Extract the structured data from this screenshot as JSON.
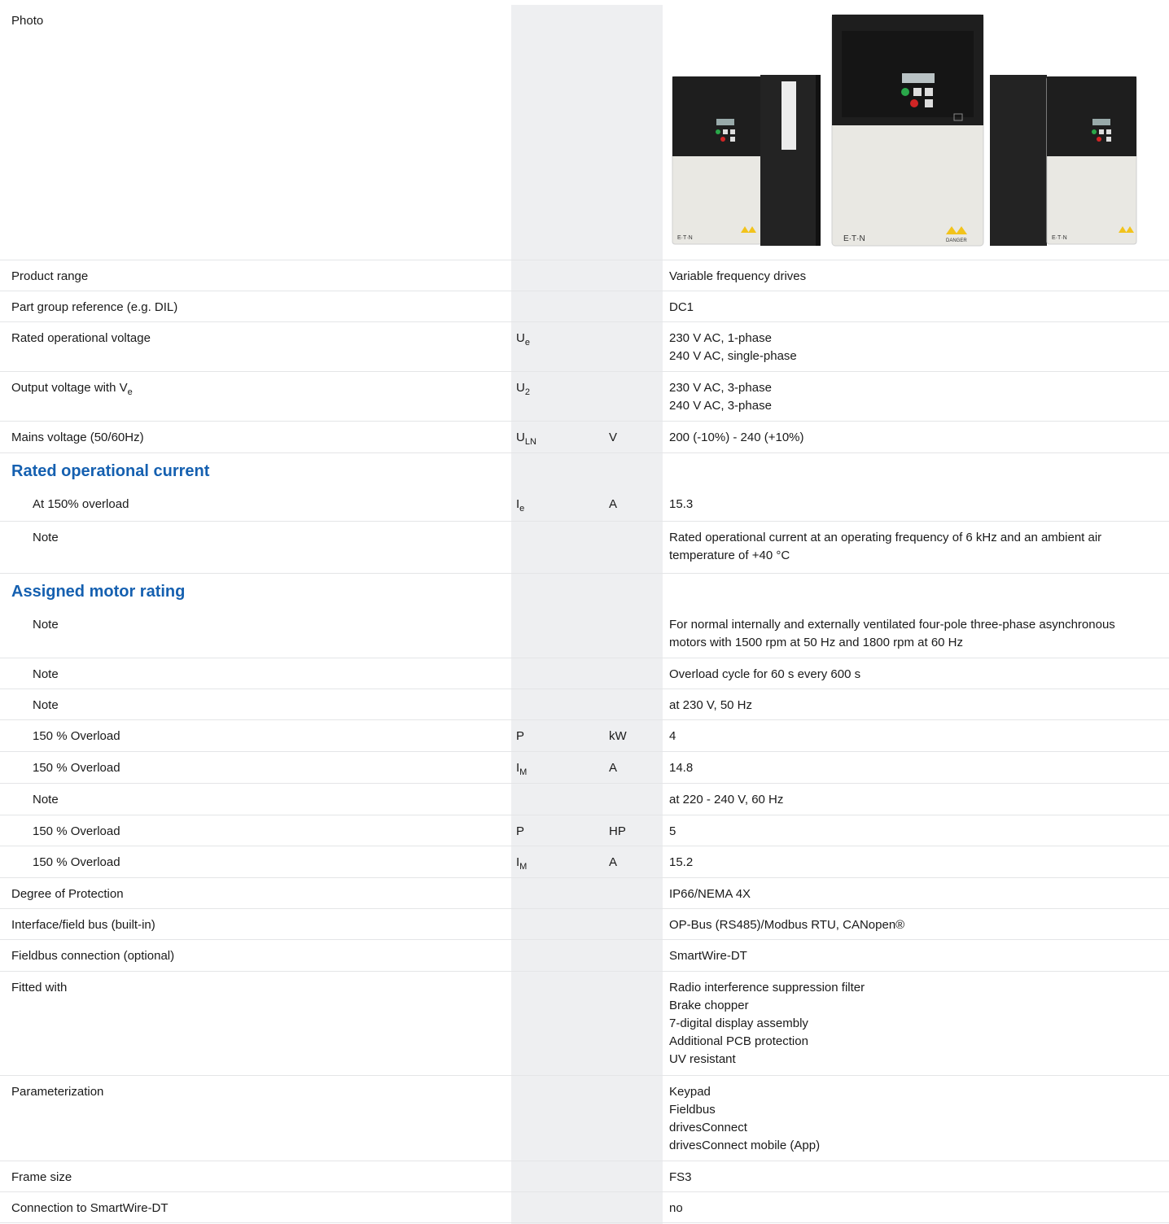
{
  "rows": [
    {
      "label": "Photo"
    },
    {
      "label": "Product range",
      "value": "Variable frequency drives"
    },
    {
      "label": "Part group reference (e.g. DIL)",
      "value": "DC1"
    },
    {
      "label": "Rated operational voltage",
      "sym": "U",
      "sym_sub": "e",
      "value_lines": [
        "230 V AC, 1-phase",
        "240 V AC, single-phase"
      ]
    },
    {
      "label": "Output voltage with V",
      "label_sub": "e",
      "sym": "U",
      "sym_sub": "2",
      "value_lines": [
        "230 V AC, 3-phase",
        "240 V AC, 3-phase"
      ]
    },
    {
      "label": "Mains voltage (50/60Hz)",
      "sym": "U",
      "sym_sub": "LN",
      "unit": "V",
      "value": "200 (-10%) - 240 (+10%)"
    },
    {
      "label": "Rated operational current"
    },
    {
      "label": "At 150% overload",
      "sym": "I",
      "sym_sub": "e",
      "unit": "A",
      "value": "15.3"
    },
    {
      "label": "Note",
      "value": "Rated operational current at an operating frequency of 6 kHz and an ambient air temperature of +40 °C"
    },
    {
      "label": "Assigned motor rating"
    },
    {
      "label": "Note",
      "value_lines": [
        "For normal internally and externally ventilated four-pole three-phase asynchronous",
        "motors with 1500 rpm at 50 Hz and 1800 rpm at 60 Hz"
      ]
    },
    {
      "label": "Note",
      "value": "Overload cycle for 60 s every 600 s"
    },
    {
      "label": "Note",
      "value": "at 230 V, 50 Hz"
    },
    {
      "label": "150 % Overload",
      "sym": "P",
      "unit": "kW",
      "value": "4"
    },
    {
      "label": "150 % Overload",
      "sym": "I",
      "sym_sub": "M",
      "unit": "A",
      "value": "14.8"
    },
    {
      "label": "Note",
      "value": "at 220 - 240 V, 60 Hz"
    },
    {
      "label": "150 % Overload",
      "sym": "P",
      "unit": "HP",
      "value": "5"
    },
    {
      "label": "150 % Overload",
      "sym": "I",
      "sym_sub": "M",
      "unit": "A",
      "value": "15.2"
    },
    {
      "label": "Degree of Protection",
      "value": "IP66/NEMA 4X"
    },
    {
      "label": "Interface/field bus (built-in)",
      "value": "OP-Bus (RS485)/Modbus RTU, CANopen®"
    },
    {
      "label": "Fieldbus connection (optional)",
      "value": "SmartWire-DT"
    },
    {
      "label": "Fitted with",
      "value_lines": [
        "Radio interference suppression filter",
        "Brake chopper",
        "7-digital display assembly",
        "Additional PCB protection",
        "UV resistant"
      ]
    },
    {
      "label": "Parameterization",
      "value_lines": [
        "Keypad",
        "Fieldbus",
        "drivesConnect",
        "drivesConnect mobile (App)"
      ]
    },
    {
      "label": "Frame size",
      "value": "FS3"
    },
    {
      "label": "Connection to SmartWire-DT",
      "value": "no"
    }
  ],
  "photo": {
    "brand": "E·T·N",
    "warning": "DANGER",
    "icons": [
      "drive-unit-icon",
      "keypad-icon",
      "warning-triangle-icon"
    ]
  },
  "colors": {
    "heading": "#1560b0",
    "shaded_column": "#eeeff1",
    "row_border": "#e4e5e7"
  }
}
